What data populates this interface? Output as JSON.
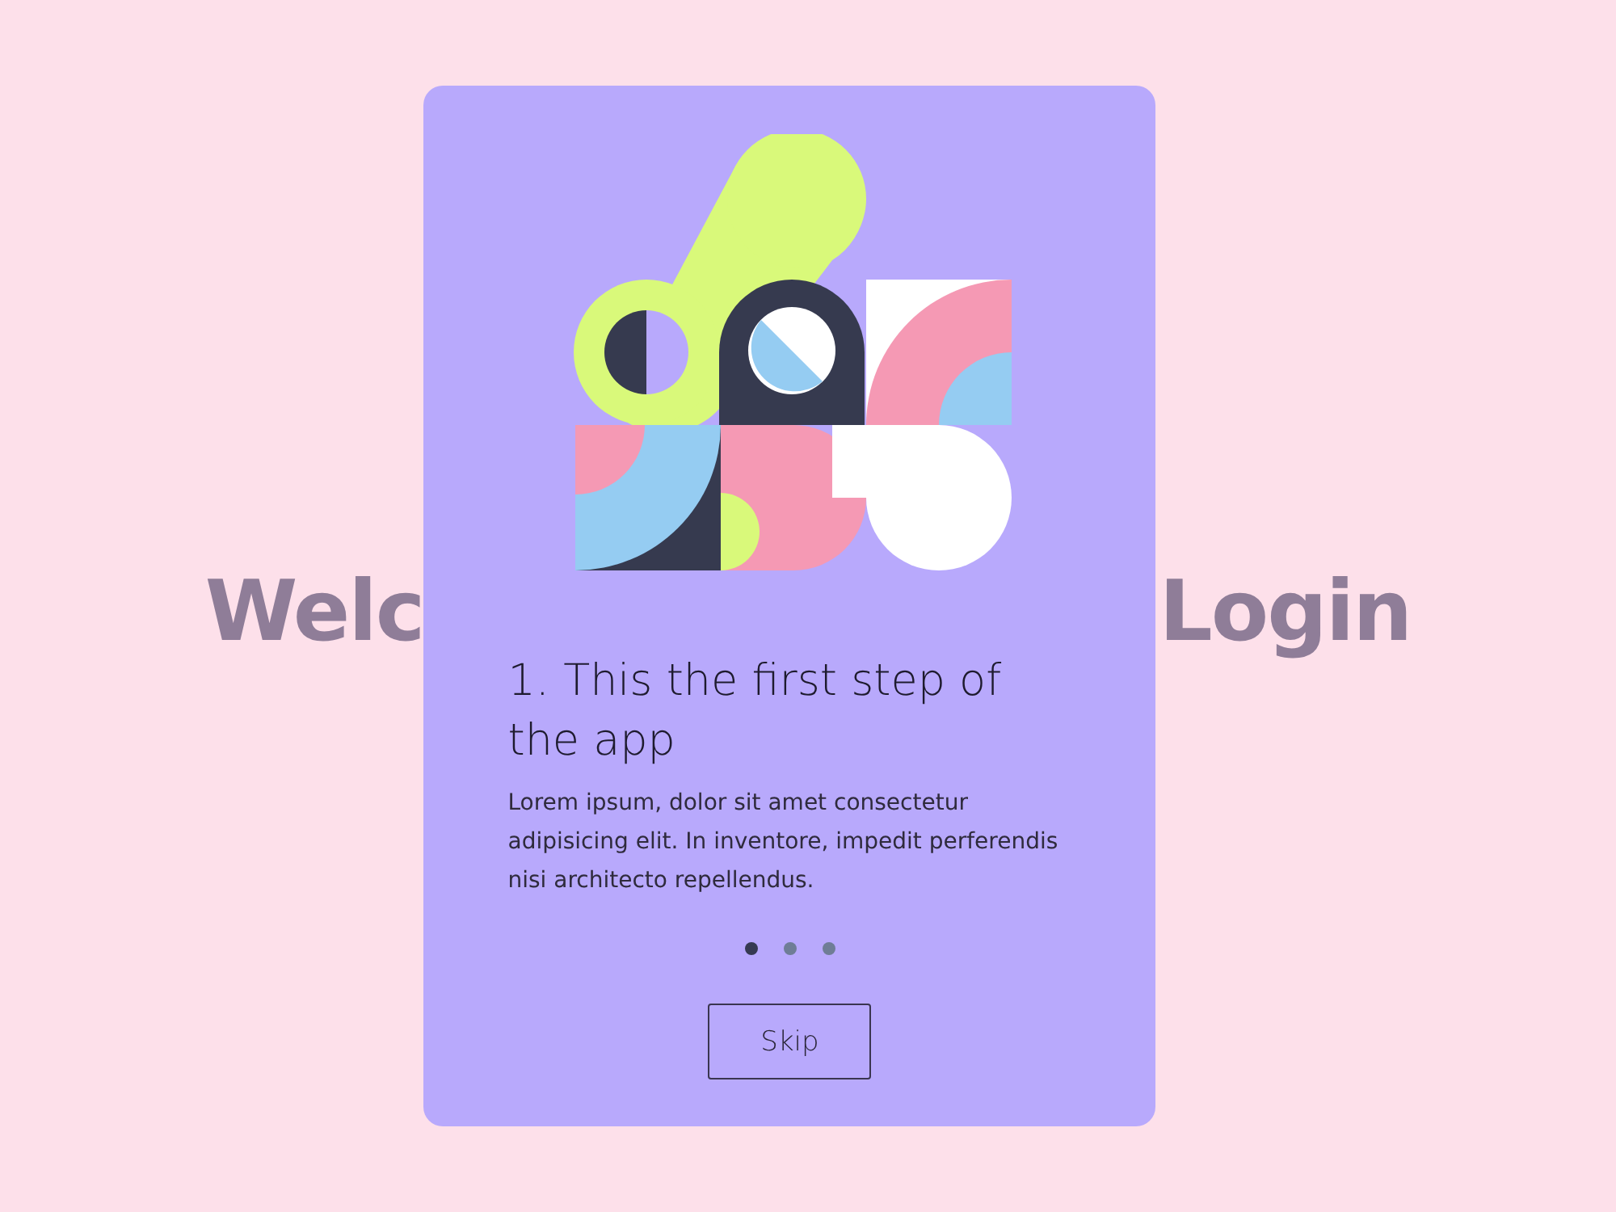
{
  "background_heading": {
    "left": "Welc",
    "right": "Login"
  },
  "onboarding_card": {
    "title": "1. This the first step of the app",
    "body": "Lorem ipsum, dolor sit amet consectetur adipisicing elit. In inventore, impedit perferendis nisi architecto repellendus.",
    "steps": [
      {
        "selected": true
      },
      {
        "selected": false
      },
      {
        "selected": false
      }
    ],
    "button": "Skip"
  }
}
